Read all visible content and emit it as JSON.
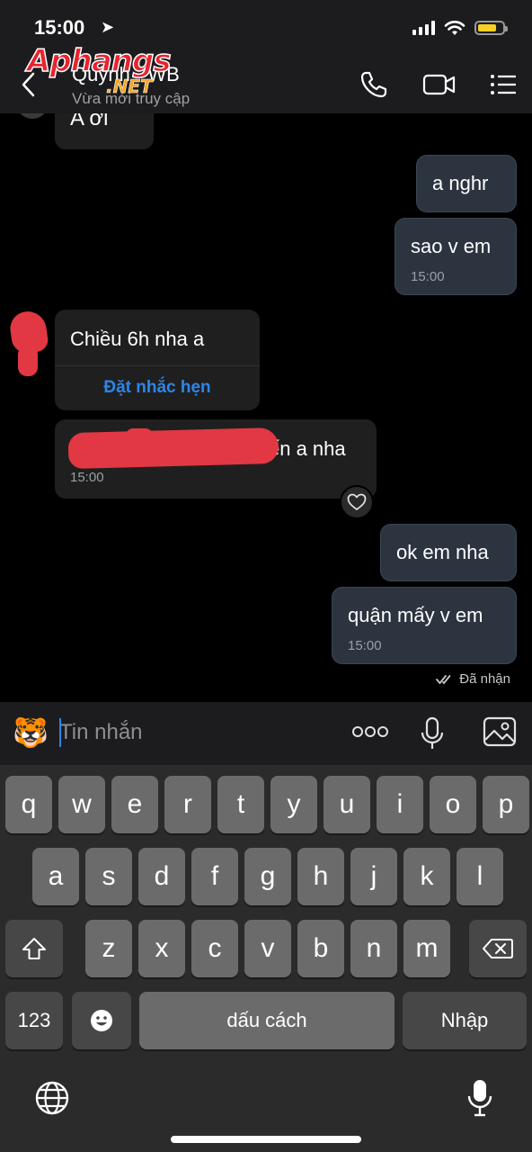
{
  "status": {
    "time": "15:00",
    "battery_fraction": 0.75
  },
  "header": {
    "contact_name": "Quỳnh - WB",
    "contact_status": "Vừa mới truy cập",
    "watermark_main": "Aphangs",
    "watermark_net": ".NET",
    "icons": [
      "back-icon",
      "phone-icon",
      "video-icon",
      "menu-icon"
    ]
  },
  "messages": {
    "m0": {
      "text": "A ơi"
    },
    "m1": {
      "text": "a nghr"
    },
    "m2": {
      "text": "sao v em",
      "time": "15:00"
    },
    "m3": {
      "text": "Chiều 6h nha a",
      "action": "Đặt nhắc hẹn"
    },
    "m4": {
      "text": "ến a nha",
      "time": "15:00"
    },
    "m5": {
      "text": "ok em nha"
    },
    "m6": {
      "text": "quận mấy v em",
      "time": "15:00"
    },
    "delivered": "Đã nhận"
  },
  "composer": {
    "emoji": "🐯",
    "placeholder": "Tin nhắn"
  },
  "keyboard": {
    "row1": [
      "q",
      "w",
      "e",
      "r",
      "t",
      "y",
      "u",
      "i",
      "o",
      "p"
    ],
    "row2": [
      "a",
      "s",
      "d",
      "f",
      "g",
      "h",
      "j",
      "k",
      "l"
    ],
    "row3": [
      "z",
      "x",
      "c",
      "v",
      "b",
      "n",
      "m"
    ],
    "numbers": "123",
    "space": "dấu cách",
    "return": "Nhập"
  },
  "colors": {
    "accent": "#2c86e8",
    "outgoing_bubble": "#2c3440",
    "incoming_bubble": "#1f1f1f",
    "redaction": "#e13843"
  }
}
